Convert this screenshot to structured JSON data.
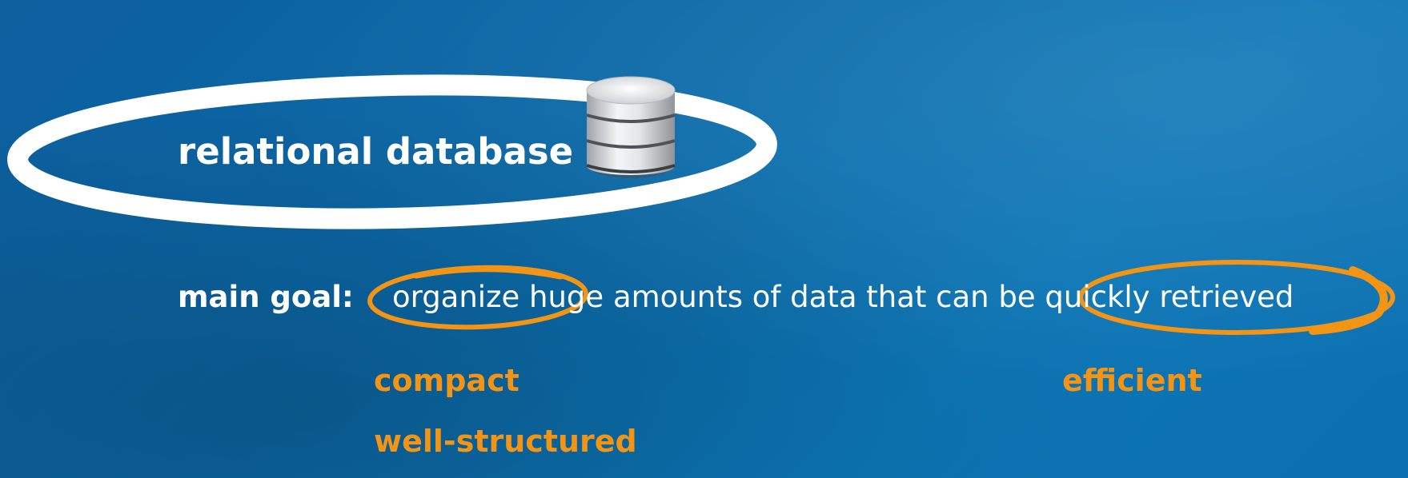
{
  "slide": {
    "title": "relational database",
    "goal_label": "main goal:",
    "goal_text": "organize huge amounts of data that can be quickly retrieved",
    "keywords": {
      "compact": "compact",
      "well_structured": "well-structured",
      "efficient": "efficient"
    }
  },
  "icons": {
    "database": "database-icon"
  },
  "colors": {
    "background": "#0b6aa8",
    "text": "#ffffff",
    "accent": "#f39414",
    "title_ring": "#ffffff"
  }
}
